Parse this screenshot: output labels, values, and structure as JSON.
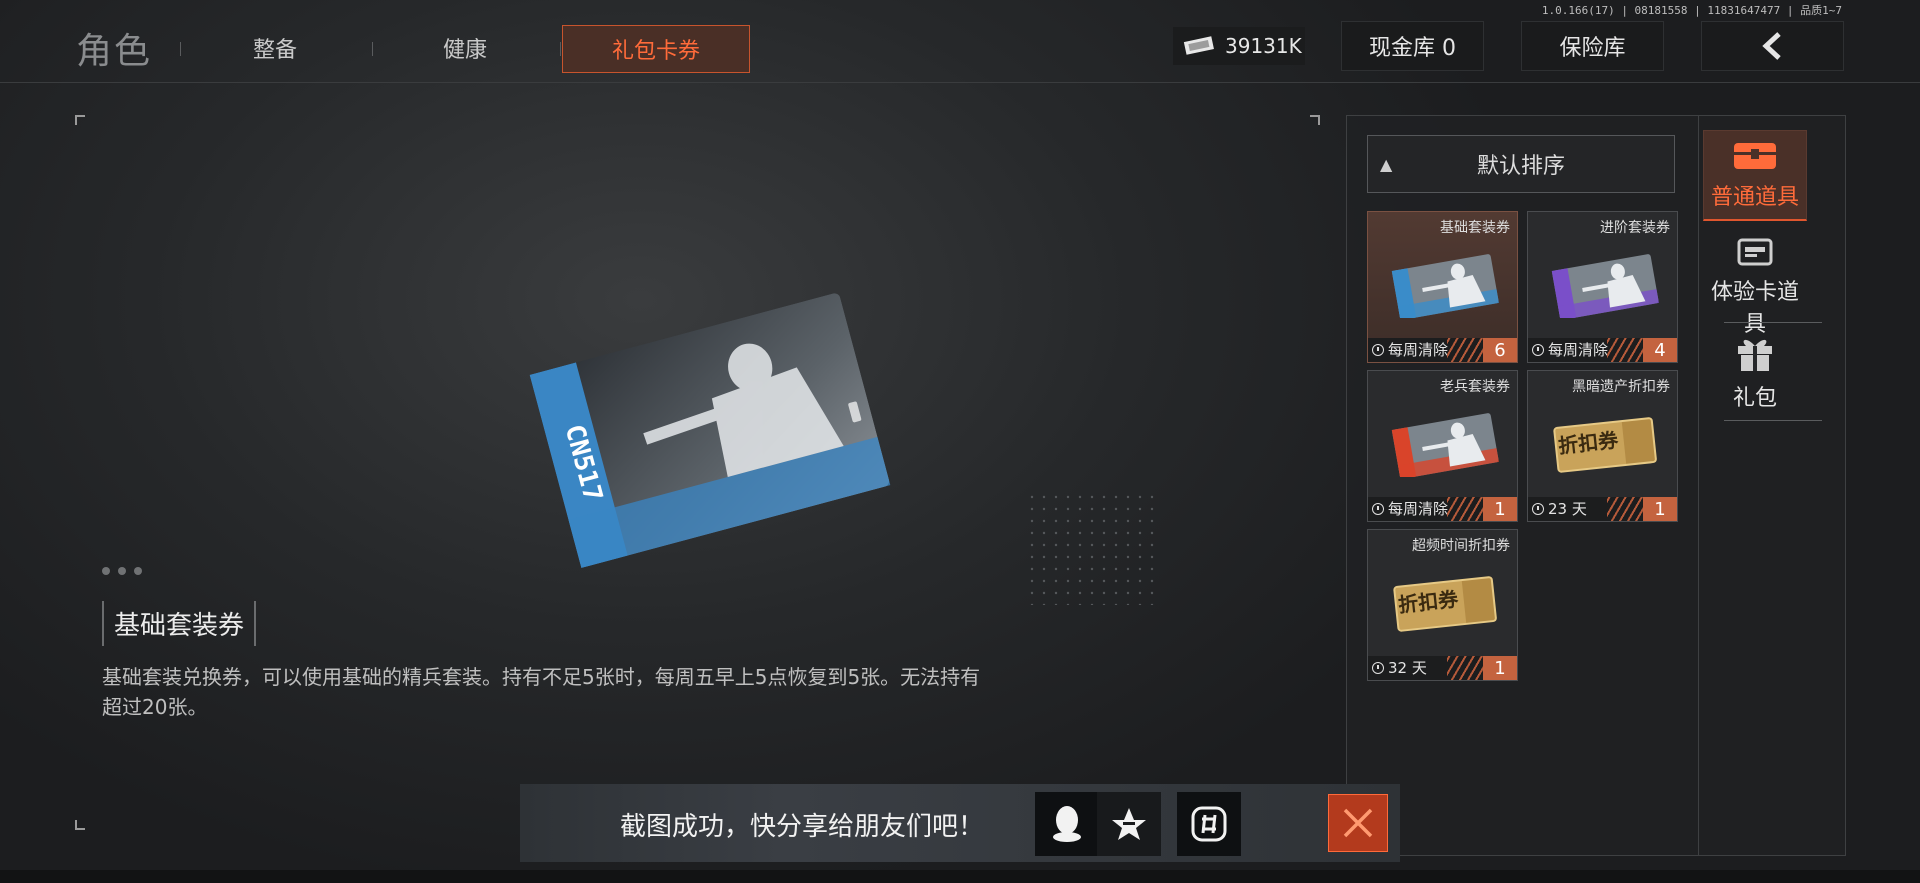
{
  "version": "1.0.166(17) | 08181558 | 11831647477 | 品质1~7",
  "header": {
    "title": "角色",
    "tabs": [
      "整备",
      "健康",
      "礼包卡券"
    ],
    "active_tab": "礼包卡券",
    "currency_value": "39131K",
    "cash_vault": "现金库 0",
    "insurance": "保险库",
    "back_icon": "chevron-left-icon"
  },
  "detail": {
    "name": "基础套装券",
    "description": "基础套装兑换券，可以使用基础的精兵套装。持有不足5张时，每周五早上5点恢复到5张。无法持有超过20张。",
    "card_text": "CN517"
  },
  "inventory": {
    "sort_label": "默认排序",
    "items": [
      {
        "name": "基础套装券",
        "timer": "每周清除",
        "count": "6",
        "kind": "card",
        "stripe": "#3a8cc9",
        "selected": true
      },
      {
        "name": "进阶套装券",
        "timer": "每周清除",
        "count": "4",
        "kind": "card",
        "stripe": "#7a4fc9",
        "selected": false
      },
      {
        "name": "老兵套装券",
        "timer": "每周清除",
        "count": "1",
        "kind": "card",
        "stripe": "#d9442a",
        "selected": false
      },
      {
        "name": "黑暗遗产折扣券",
        "timer": "23 天",
        "count": "1",
        "kind": "coupon",
        "coupon_text": "折扣券",
        "selected": false
      },
      {
        "name": "超频时间折扣券",
        "timer": "32 天",
        "count": "1",
        "kind": "coupon",
        "coupon_text": "折扣券",
        "selected": false
      }
    ]
  },
  "categories": [
    {
      "label": "普通道具",
      "icon": "chest-icon",
      "active": true
    },
    {
      "label": "体验卡道具",
      "icon": "card-icon",
      "active": false
    },
    {
      "label": "礼包",
      "icon": "gift-icon",
      "active": false
    }
  ],
  "share": {
    "text": "截图成功，快分享给朋友们吧！",
    "icons": [
      "qq-icon",
      "qzone-icon",
      "wechat-moments-icon"
    ],
    "close_icon": "close-icon"
  },
  "colors": {
    "accent": "#ff6b3a",
    "count_bg": "#c4633f",
    "close_bg": "#b33a1d"
  }
}
